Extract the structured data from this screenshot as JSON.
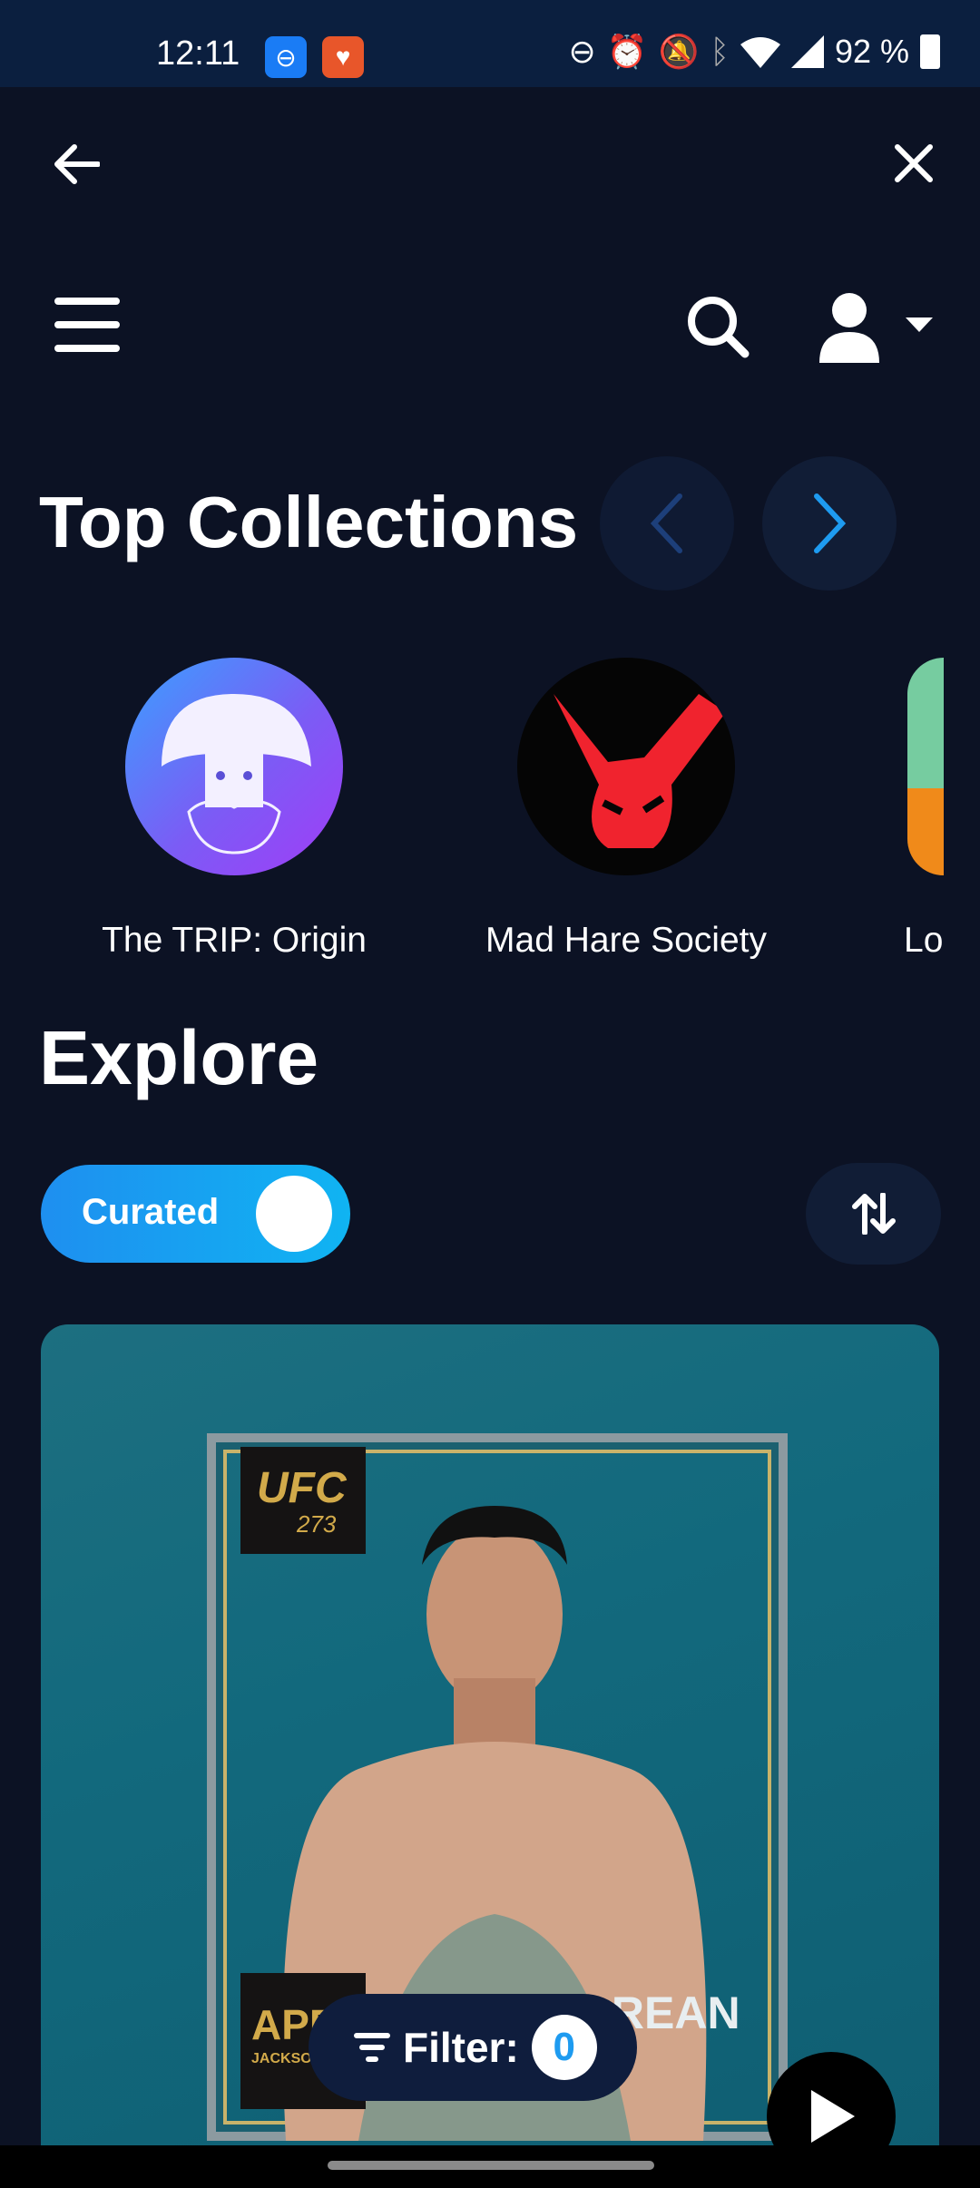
{
  "status_bar": {
    "time": "12:11",
    "battery": "92 %",
    "icons": [
      "messenger-icon",
      "heart-app-icon",
      "dnd-icon",
      "alarm-icon",
      "bell-off-icon",
      "bluetooth-icon",
      "wifi-icon",
      "signal-icon",
      "battery-icon"
    ]
  },
  "top_bar": {
    "back_icon": "arrow-left-icon",
    "close_icon": "close-icon"
  },
  "header": {
    "menu_icon": "hamburger-icon",
    "search_icon": "search-icon",
    "user_icon": "user-icon"
  },
  "top_collections": {
    "title": "Top Collections",
    "items": [
      {
        "label": "The TRIP: Origin"
      },
      {
        "label": "Mad Hare Society"
      },
      {
        "label": "Lo"
      }
    ]
  },
  "explore": {
    "title": "Explore",
    "toggle_label": "Curated",
    "toggle_on": true,
    "sort_icon": "sort-arrows-icon"
  },
  "card": {
    "badge_top": "UFC",
    "badge_top_num": "273",
    "badge_bottom": "APP",
    "badge_bottom_sub": "JACKSO",
    "title_text": "THE KOREAN"
  },
  "filter": {
    "label": "Filter:",
    "count": "0"
  },
  "colors": {
    "background": "#0c1224",
    "status_bar": "#0b1f3f",
    "accent": "#1e9bf0",
    "toggle_start": "#1e9bf0",
    "toggle_end": "#10b0f0"
  }
}
